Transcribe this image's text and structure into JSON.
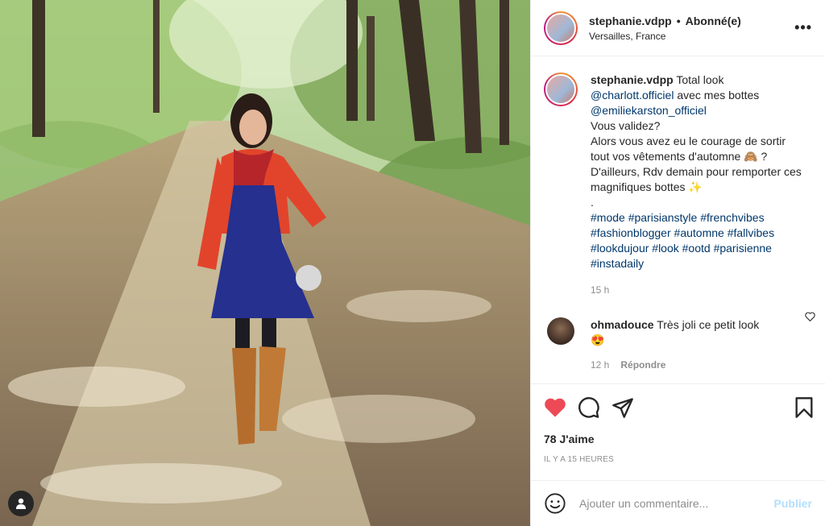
{
  "post": {
    "username": "stephanie.vdpp",
    "follow_status": "Abonné(e)",
    "location": "Versailles, France",
    "more_icon": "more-horizontal-icon"
  },
  "caption": {
    "username": "stephanie.vdpp",
    "text_start": "Total look",
    "mention1": "@charlott.officiel",
    "text_mid": "avec mes bottes",
    "mention2": "@emiliekarston_officiel",
    "line_a": "Vous validez?",
    "line_b": "Alors vous avez eu le courage de sortir tout vos vêtements d'automne 🙈 ?",
    "line_c": "D'ailleurs, Rdv demain pour remporter ces magnifiques bottes ✨",
    "dot": ".",
    "hashtags": [
      "#mode",
      "#parisianstyle",
      "#frenchvibes",
      "#fashionblogger",
      "#automne",
      "#fallvibes",
      "#lookdujour",
      "#look",
      "#ootd",
      "#parisienne",
      "#instadaily"
    ],
    "time": "15 h"
  },
  "comment": {
    "username": "ohmadouce",
    "text": "Très joli ce petit look",
    "emoji": "😍",
    "time": "12 h",
    "reply": "Répondre"
  },
  "stats": {
    "likes": "78 J'aime",
    "posted": "IL Y A 15 HEURES"
  },
  "composer": {
    "placeholder": "Ajouter un commentaire...",
    "publish": "Publier"
  },
  "colors": {
    "like_red": "#ed4956",
    "link_blue": "#00376b",
    "publish_disabled": "#b2dffc"
  }
}
